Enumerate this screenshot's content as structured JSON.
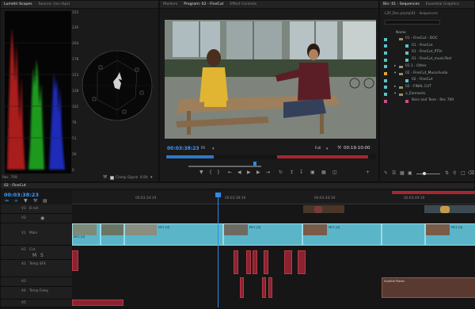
{
  "lumetri": {
    "tabs": [
      "Lumetri Scopes",
      "Source: (no clips)"
    ],
    "scale_right": [
      "255",
      "230",
      "204",
      "178",
      "153",
      "128",
      "102",
      "76",
      "51",
      "26",
      "0"
    ],
    "footer_label": "Rec. 709",
    "clamp_label": "Clamp Signal",
    "bits_value": "8 Bit"
  },
  "program": {
    "tabs": [
      "Markers",
      "Program: 02 - FineCut",
      "Effect Controls"
    ],
    "timecode": "00:03:38:23",
    "fit_value": "Fit",
    "quality_value": "Full",
    "duration": "00:19:10:00"
  },
  "bin": {
    "tabs": [
      "Bin: 01 - Sequences",
      "Essential Graphics"
    ],
    "path": "L2P_Doc.prproj\\01 - Sequences",
    "column_header": "Name",
    "rows": [
      {
        "label": "01 - FineCut - DOC",
        "color": "#59c4c9"
      },
      {
        "label": "01 - FineCut",
        "color": "#59c4c9"
      },
      {
        "label": "01 - FineCut_PT0r",
        "color": "#59c4c9"
      },
      {
        "label": "01 - FineCut_musicTest",
        "color": "#59c4c9"
      },
      {
        "label": "01.1 - Other",
        "color": "#59c4c9"
      },
      {
        "label": "02 - FineCut_MusicAudio",
        "color": "#e6a532"
      },
      {
        "label": "02 - FineCut",
        "color": "#59c4c9"
      },
      {
        "label": "02 - FINAL CUT",
        "color": "#59c4c9"
      },
      {
        "label": "a_Elements",
        "color": "#59c4c9"
      },
      {
        "label": "Bars and Tone - Rec 709",
        "color": "#d24a8d"
      }
    ]
  },
  "timeline": {
    "tab": "02 - FineCut",
    "timecode": "00:03:38:23",
    "ruler": [
      "00:03:34:19",
      "00:03:39:19",
      "00:03:44:19",
      "00:03:49:19"
    ],
    "tracks": [
      {
        "id": "V3",
        "name": "B roll"
      },
      {
        "id": "V2",
        "name": ""
      },
      {
        "id": "V1",
        "name": "Main"
      },
      {
        "id": "A1",
        "name": "Cut"
      },
      {
        "id": "A2",
        "name": "Temp SFX"
      },
      {
        "id": "A3",
        "name": ""
      },
      {
        "id": "A4",
        "name": "Temp Foley"
      },
      {
        "id": "A5",
        "name": ""
      }
    ],
    "clip_labels": [
      "MC1 [V]",
      "MC1 [V]",
      "MC1 [V]",
      "MC1 [V]",
      "MC1 [V]"
    ],
    "audio_clip_label": "Subtitle Plates"
  },
  "colors": {
    "accent": "#2d8ceb",
    "video_clip": "#5ab5c8",
    "audio_clip": "#8b2230",
    "playhead": "#2d8ceb"
  }
}
